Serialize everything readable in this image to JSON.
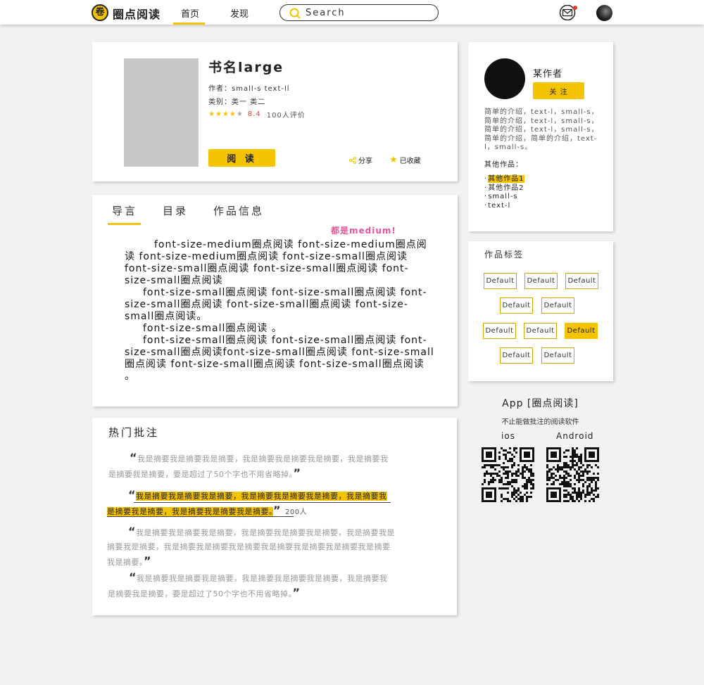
{
  "brand": {
    "badge": "卷",
    "name": "圈点阅读"
  },
  "nav": {
    "home": "首页",
    "discover": "发现"
  },
  "search": {
    "value": "Search"
  },
  "colors": {
    "accent": "#f5c400",
    "score": "#e04a2e",
    "highlight_note": "#e8559c",
    "notify_dot": "#e63b2e"
  },
  "icons": {
    "search": "search-icon",
    "mail": "mail-icon",
    "share": "share-icon",
    "star": "star-icon"
  },
  "book": {
    "title": "书名large",
    "author_line": "作者：small-s text-ll",
    "category_line": "类别：类一 类二",
    "rating_stars": 4,
    "score": "8.4",
    "rating_count": "100人评价",
    "read_label": "阅 读",
    "share_label": "分享",
    "collected_label": "已收藏"
  },
  "tabs": [
    "导言",
    "目录",
    "作品信息"
  ],
  "note": "都是medium!",
  "intro": [
    "font-size-medium圈点阅读 font-size-medium圈点阅读 font-size-medium圈点阅读 font-size-small圈点阅读 font-size-small圈点阅读 font-size-small圈点阅读 font-size-small圈点阅读",
    "font-size-small圈点阅读 font-size-small圈点阅读 font-size-small圈点阅读 font-size-small圈点阅读 font-size-small圈点阅读。",
    "font-size-small圈点阅读 。",
    "font-size-small圈点阅读 font-size-small圈点阅读 font-size-small圈点阅读font-size-small圈点阅读 font-size-small圈点阅读 font-size-small圈点阅读 font-size-small圈点阅读 。"
  ],
  "hot": {
    "title": "热门批注",
    "q1": "我是摘要我是摘要我是摘要，我是摘要我是摘要我是摘要，我是摘要我是摘要我是摘要，要是超过了50个字也不用省略掉。",
    "q2": "我是摘要我是摘要我是摘要，我是摘要我是摘要我是摘要，我是摘要我是摘要我是摘要，我是摘要我是摘要我是摘要。",
    "q2_count": "200人",
    "q3": "我是摘要我是摘要我是摘要，我是摘要我是摘要我是摘要，我是摘要我是摘要我是摘要，我是摘要我是摘要我是摘要我是摘要我是摘要我是摘要我是摘要我是摘要。",
    "q4": "我是摘要我是摘要我是摘要，我是摘要我是摘要我是摘要，我是摘要我是摘要我是摘要，要是超过了50个字也不用省略掉。"
  },
  "author": {
    "name": "某作者",
    "follow": "关 注",
    "bio": "简单的介绍，text-l，small-s，简单的介绍，text-l，small-s，简单的介绍，text-l，small-s，简单的介绍，简单的介绍，text-l，small-s。",
    "other_title": "其他作品：",
    "works": [
      "其他作品1",
      "其他作品2",
      "small-s",
      "text-l"
    ]
  },
  "tags": {
    "title": "作品标签",
    "items": [
      "Default",
      "Default",
      "Default",
      "Default",
      "Default",
      "Default",
      "Default",
      "Default",
      "Default",
      "Default"
    ],
    "selected_index": 7
  },
  "app": {
    "title": "App [圈点阅读]",
    "subtitle": "不止能做批注的阅读软件",
    "ios": "ios",
    "android": "Android"
  }
}
